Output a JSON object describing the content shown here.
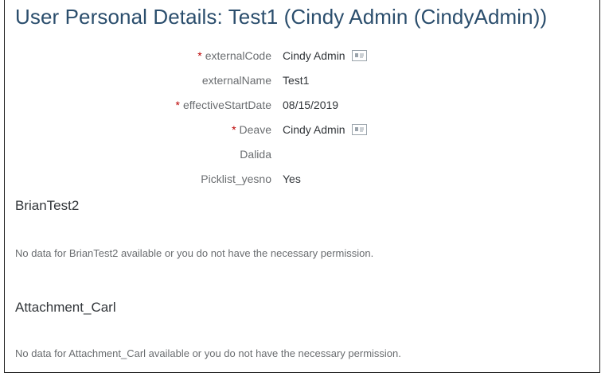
{
  "page_title": "User Personal Details: Test1 (Cindy Admin (CindyAdmin))",
  "fields": [
    {
      "label": "externalCode",
      "required": "*",
      "value": "Cindy Admin",
      "icon": "business-card-icon"
    },
    {
      "label": "externalName",
      "required": "",
      "value": "Test1"
    },
    {
      "label": "effectiveStartDate",
      "required": "*",
      "value": "08/15/2019"
    },
    {
      "label": "Deave",
      "required": "*",
      "value": "Cindy Admin",
      "icon": "business-card-icon"
    },
    {
      "label": "Dalida",
      "required": "",
      "value": ""
    },
    {
      "label": "Picklist_yesno",
      "required": "",
      "value": "Yes"
    }
  ],
  "sections": [
    {
      "title": "BrianTest2",
      "message": "No data for BrianTest2 available or you do not have the necessary permission."
    },
    {
      "title": "Attachment_Carl",
      "message": "No data for Attachment_Carl available or you do not have the necessary permission."
    }
  ],
  "colors": {
    "title": "#2b4e6d",
    "required": "#bb0000",
    "label": "#6a6d70",
    "text": "#32363a"
  }
}
